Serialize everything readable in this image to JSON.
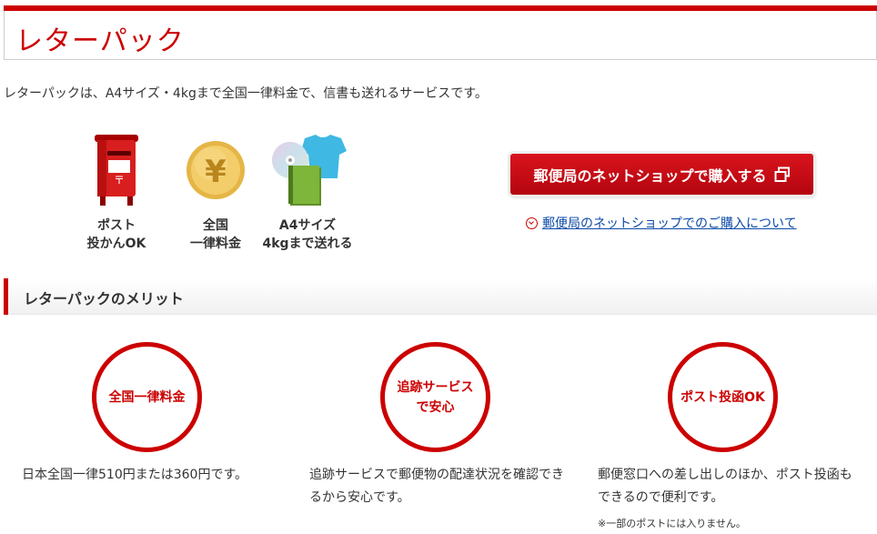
{
  "header": {
    "title": "レターパック"
  },
  "intro": {
    "text": "レターパックは、A4サイズ・4kgまで全国一律料金で、信書も送れるサービスです。"
  },
  "features": [
    {
      "icon": "mailbox-icon",
      "line1": "ポスト",
      "line2": "投かんOK"
    },
    {
      "icon": "yen-coin-icon",
      "line1": "全国",
      "line2": "一律料金"
    },
    {
      "icon": "cd-book-shirt-icon",
      "line1": "A4サイズ",
      "line2": "4kgまで送れる"
    }
  ],
  "purchase": {
    "button_label": "郵便局のネットショップで購入する",
    "link_label": "郵便局のネットショップでのご購入について"
  },
  "merits": {
    "heading": "レターパックのメリット",
    "items": [
      {
        "circle_line1": "全国一律料金",
        "circle_line2": "",
        "text": "日本全国一律510円または360円です。"
      },
      {
        "circle_line1": "追跡サービス",
        "circle_line2": "で安心",
        "text": "追跡サービスで郵便物の配達状況を確認できるから安心です。"
      },
      {
        "circle_line1": "ポスト投函OK",
        "circle_line2": "",
        "text": "郵便窓口への差し出しのほか、ポスト投函もできるので便利です。"
      }
    ],
    "note": "※一部のポストには入りません。"
  },
  "colors": {
    "brand_red": "#cc0000",
    "link_blue": "#0b4aa8",
    "text": "#333333"
  }
}
